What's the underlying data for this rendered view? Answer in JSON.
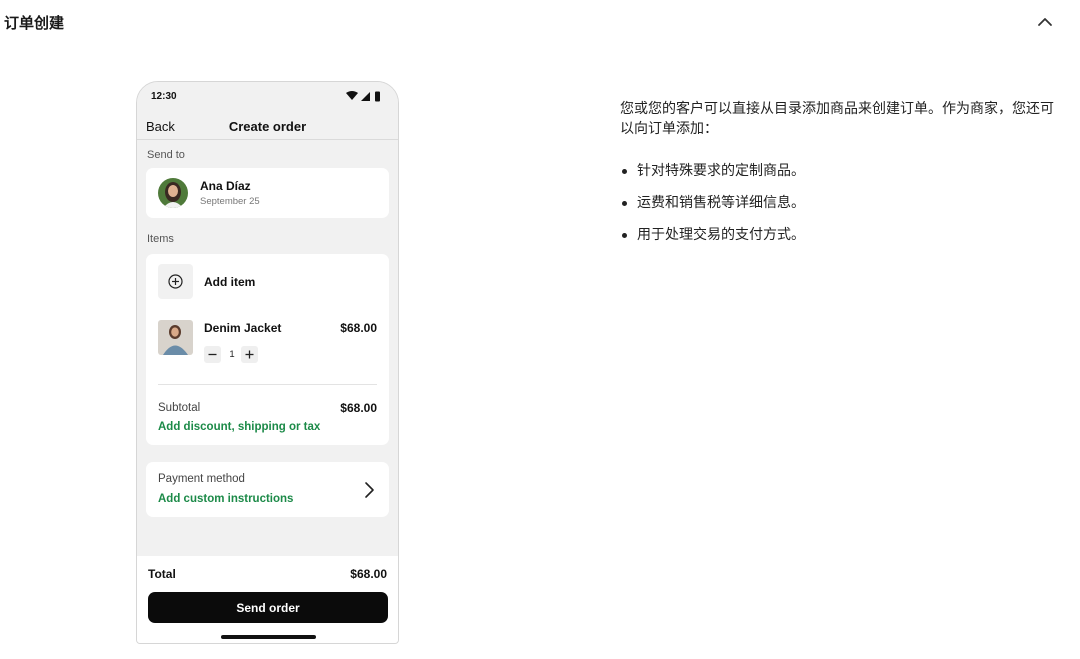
{
  "section": {
    "title": "订单创建",
    "toggle_icon": "chevron-up-icon"
  },
  "phone": {
    "status_time": "12:30",
    "status_icons": [
      "wifi-icon",
      "signal-icon",
      "battery-icon"
    ],
    "nav": {
      "back_label": "Back",
      "title": "Create order"
    },
    "send_to": {
      "label": "Send to",
      "customer_name": "Ana Díaz",
      "customer_date": "September 25"
    },
    "items": {
      "label": "Items",
      "add_item_label": "Add item",
      "products": [
        {
          "name": "Denim Jacket",
          "price": "$68.00",
          "quantity": "1"
        }
      ],
      "subtotal_label": "Subtotal",
      "subtotal_value": "$68.00",
      "discount_link": "Add discount, shipping or tax"
    },
    "payment": {
      "label": "Payment method",
      "instructions_link": "Add custom instructions"
    },
    "footer": {
      "total_label": "Total",
      "total_value": "$68.00",
      "send_button": "Send order"
    }
  },
  "description": {
    "intro": "您或您的客户可以直接从目录添加商品来创建订单。作为商家，您还可以向订单添加：",
    "bullets": [
      "针对特殊要求的定制商品。",
      "运费和销售税等详细信息。",
      "用于处理交易的支付方式。"
    ]
  },
  "colors": {
    "accent_green": "#1c8a48",
    "primary_button": "#0b0b0b",
    "phone_background": "#f1f1f1"
  }
}
